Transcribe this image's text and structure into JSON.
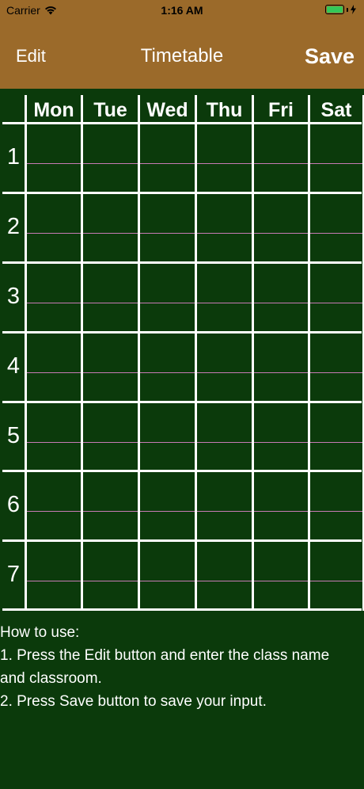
{
  "status_bar": {
    "carrier": "Carrier",
    "time": "1:16 AM",
    "battery_color": "#34c759"
  },
  "nav": {
    "edit_label": "Edit",
    "title": "Timetable",
    "save_label": "Save",
    "bg_color": "#9b6a2a"
  },
  "timetable": {
    "days": [
      "Mon",
      "Tue",
      "Wed",
      "Thu",
      "Fri",
      "Sat"
    ],
    "periods": [
      "1",
      "2",
      "3",
      "4",
      "5",
      "6",
      "7"
    ],
    "board_color": "#0b3a0b",
    "line_color": "#ffffff",
    "separator_color": "#c77bb5"
  },
  "instructions": {
    "lines": [
      "How to use:",
      "1. Press the Edit button and enter the class name",
      "and classroom.",
      "2. Press Save button to save your input."
    ]
  }
}
